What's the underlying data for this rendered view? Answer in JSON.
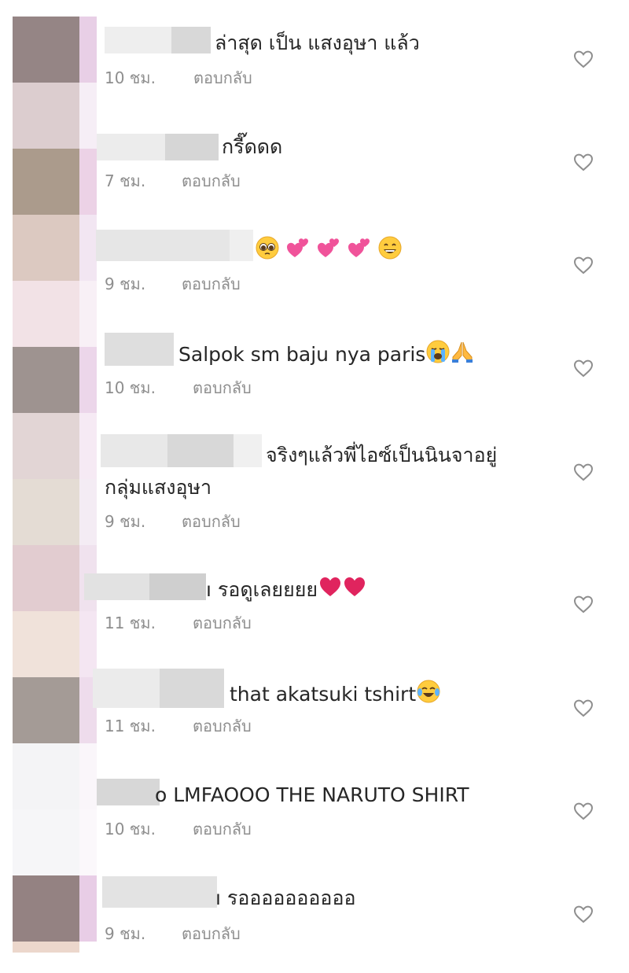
{
  "comments": [
    {
      "text": "ล่าสุด เป็น แสงอุษา แล้ว",
      "time": "10 ชม.",
      "reply": "ตอบกลับ"
    },
    {
      "text": "กรี๊ดดด",
      "time": "7 ชม.",
      "reply": "ตอบกลับ"
    },
    {
      "text": "",
      "emojis": [
        "pleading-face",
        "two-hearts",
        "two-hearts",
        "two-hearts",
        "grinning-face"
      ],
      "time": "9 ชม.",
      "reply": "ตอบกลับ"
    },
    {
      "text": "Salpok sm baju nya paris",
      "emojis": [
        "loudly-crying-face",
        "folded-hands"
      ],
      "time": "10 ชม.",
      "reply": "ตอบกลับ"
    },
    {
      "text": "จริงๆแล้วพี่ไอซ์เป็นนินจาอยู่",
      "text2": "กลุ่มแสงอุษา",
      "time": "9 ชม.",
      "reply": "ตอบกลับ"
    },
    {
      "text": "ı รอดูเลยยยย",
      "emojis": [
        "red-heart",
        "red-heart"
      ],
      "time": "11 ชม.",
      "reply": "ตอบกลับ"
    },
    {
      "text": "that akatsuki tshirt",
      "emojis": [
        "face-with-tears-of-joy"
      ],
      "time": "11 ชม.",
      "reply": "ตอบกลับ"
    },
    {
      "text": "o LMFAOOO THE NARUTO SHIRT",
      "time": "10 ชม.",
      "reply": "ตอบกลับ"
    },
    {
      "text": "ı รออออออออออ",
      "time": "9 ชม.",
      "reply": "ตอบกลับ"
    }
  ],
  "like_icon": "heart-outline-icon",
  "colors": {
    "text": "#262626",
    "meta": "#8e8e8e",
    "heart": "#8e8e8e",
    "heart_emoji": "#e0245e",
    "pink_heart_emoji": "#f0539a",
    "blur": "#d9d9d9"
  }
}
